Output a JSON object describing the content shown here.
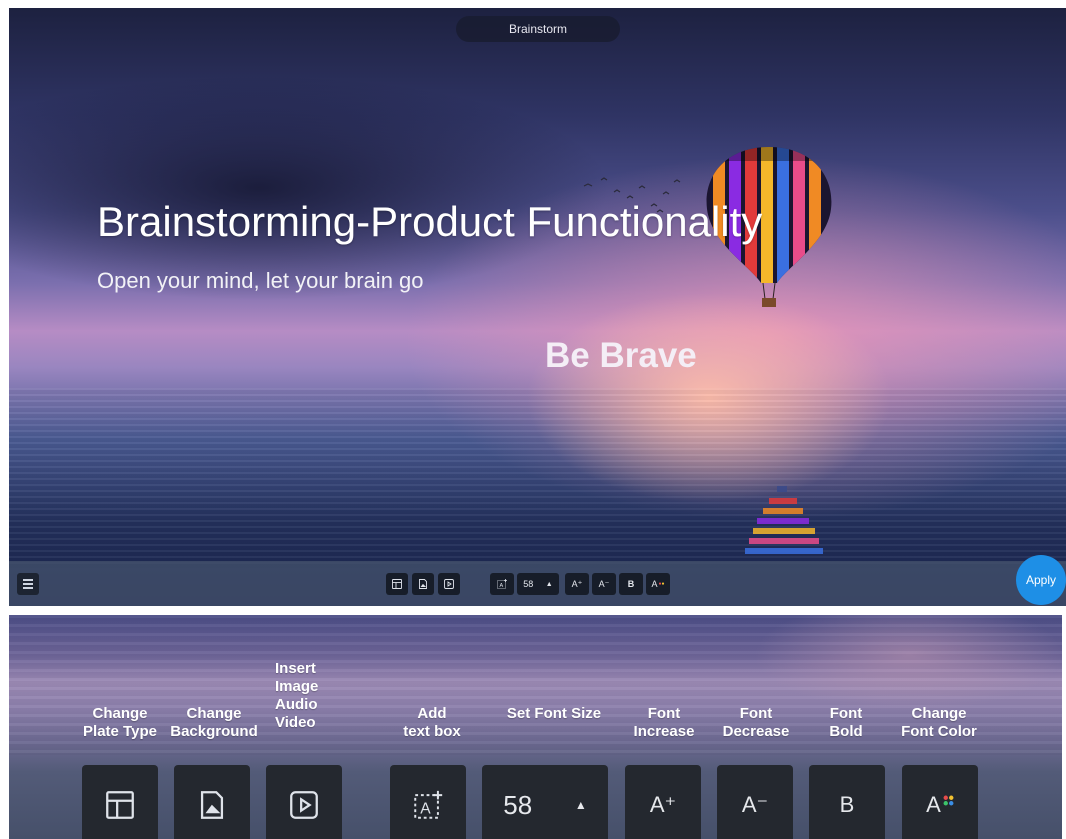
{
  "screen": {
    "window_title": "Brainstorm",
    "slide": {
      "title": "Brainstorming-Product Functionality",
      "subtitle": "Open your mind, let your brain go",
      "callout": "Be Brave"
    },
    "toolbar": {
      "font_size": "58",
      "font_increase_glyph": "A⁺",
      "font_decrease_glyph": "A⁻",
      "bold_glyph": "B",
      "font_color_glyph": "A"
    },
    "apply_label": "Apply"
  },
  "callouts": {
    "labels": {
      "plate_type": "Change\nPlate Type",
      "background": "Change\nBackground",
      "media": "Insert\nImage\nAudio\nVideo",
      "text_box": "Add\ntext box",
      "font_size": "Set Font Size",
      "font_increase": "Font\nIncrease",
      "font_decrease": "Font\nDecrease",
      "font_bold": "Font\nBold",
      "font_color": "Change\nFont Color"
    },
    "font_size": "58",
    "font_increase_glyph": "A⁺",
    "font_decrease_glyph": "A⁻",
    "bold_glyph": "B",
    "font_color_glyph": "A"
  },
  "icons": [
    "menu-icon",
    "plate-type-icon",
    "background-image-icon",
    "media-play-icon",
    "add-textbox-icon",
    "caret-up-icon",
    "color-dots-icon"
  ],
  "colors": {
    "apply_button": "#1e8fe6",
    "toolbar_button": "#24282f",
    "dot_red": "#e84c4c",
    "dot_yellow": "#f2c230",
    "dot_green": "#3cc46a",
    "dot_blue": "#3a8ee6"
  }
}
